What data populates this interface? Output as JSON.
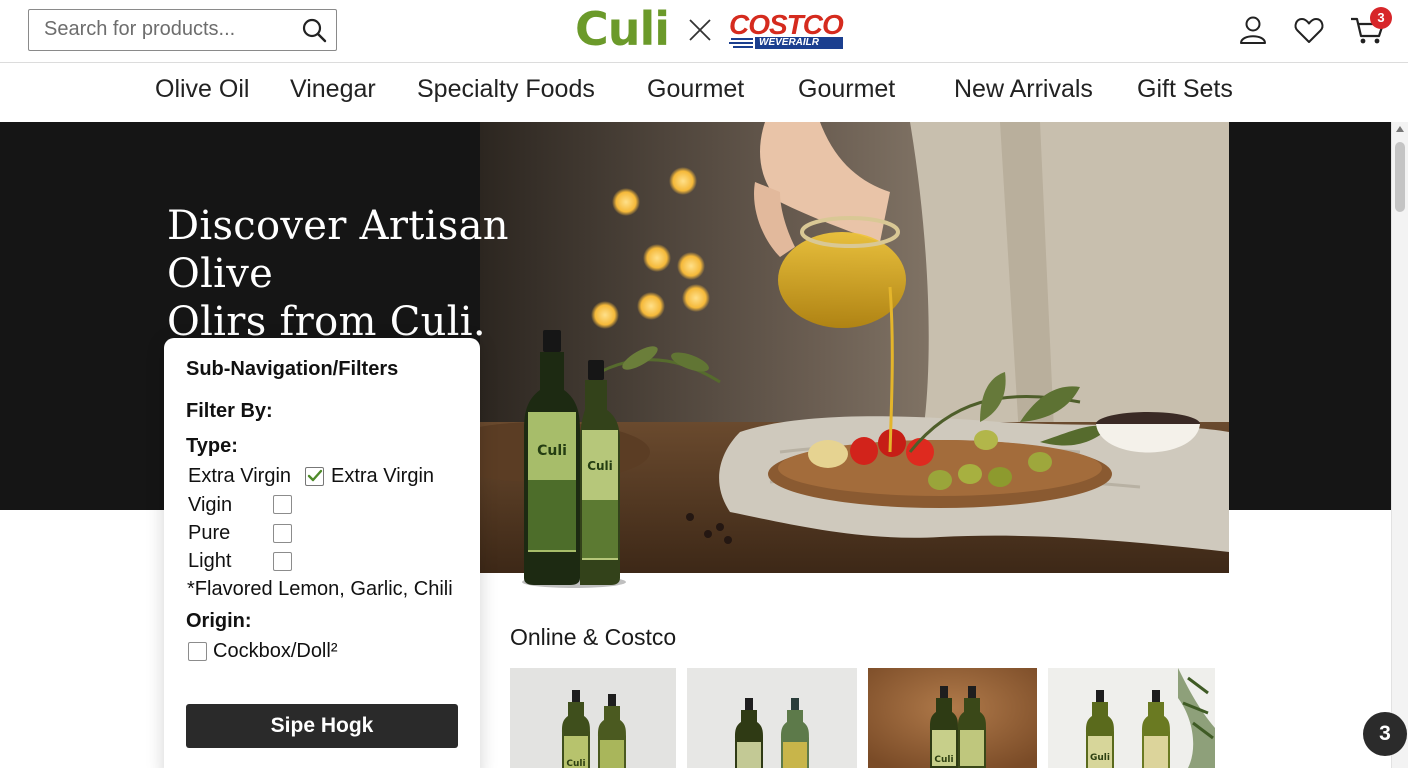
{
  "header": {
    "search_placeholder": "Search for products...",
    "brand_primary": "Culi",
    "brand_partner": "COSTCO",
    "brand_partner_sub": "WEVERAILR",
    "cart_count": "3",
    "colors": {
      "culi_green": "#6b9a2a",
      "costco_red": "#d52b1e",
      "costco_blue": "#1b3f8f",
      "badge_red": "#d7262a"
    }
  },
  "nav": {
    "items": [
      {
        "label": "Olive Oil"
      },
      {
        "label": "Vinegar"
      },
      {
        "label": "Specialty Foods"
      },
      {
        "label": "Gourmet"
      },
      {
        "label": "Gourmet"
      },
      {
        "label": "New Arrivals"
      },
      {
        "label": "Gift Sets"
      }
    ]
  },
  "hero": {
    "title_line1": "Discover Artisan Olive",
    "title_line2": "Olirs from Culi.",
    "bottle_label": "Culi"
  },
  "filters": {
    "title": "Sub-Navigation/Filters",
    "filter_by": "Filter By:",
    "type_label": "Type:",
    "types": [
      {
        "label": "Extra Virgin",
        "checked_label": "Extra Virgin",
        "checked": true
      },
      {
        "label": "Vigin",
        "checked": false
      },
      {
        "label": "Pure",
        "checked": false
      },
      {
        "label": "Light",
        "checked": false
      }
    ],
    "flavored_note": "*Flavored Lemon, Garlic, Chili",
    "origin_label": "Origin:",
    "origins": [
      {
        "label": "Cockbox/Doll²",
        "checked": false
      }
    ],
    "button_label": "Sipe Hogk"
  },
  "products": {
    "section_title": "Online & Costco",
    "tiles": [
      {
        "bottle_label": "Culi"
      },
      {
        "bottle_label": ""
      },
      {
        "bottle_label": "Culi"
      },
      {
        "bottle_label": "Guli"
      }
    ]
  },
  "floating_badge": "3"
}
